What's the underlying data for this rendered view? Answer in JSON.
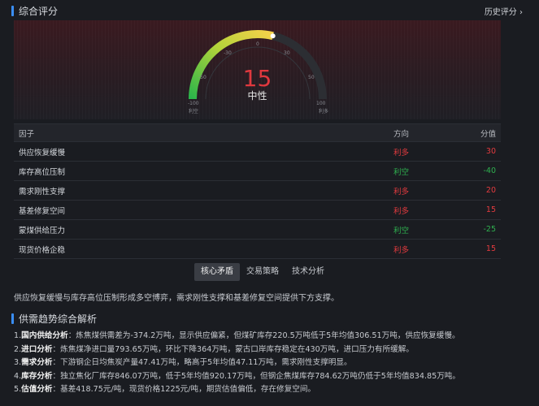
{
  "header": {
    "title": "综合评分",
    "history_link": "历史评分"
  },
  "gauge": {
    "value": "15",
    "label": "中性",
    "score_fraction": 0.575,
    "tick_labels": [
      "-100",
      "-50",
      "-30",
      "0",
      "30",
      "50",
      "100"
    ],
    "left_caption": "利空",
    "right_caption": "利多",
    "colors": {
      "start": "#2bb64a",
      "mid": "#c9d82e",
      "end": "#f6c94a",
      "track": "#2c2e33"
    }
  },
  "table": {
    "columns": [
      "因子",
      "方向",
      "分值"
    ],
    "rows": [
      {
        "factor": "供应恢复缓慢",
        "direction": "利多",
        "score": "30",
        "tone": "red"
      },
      {
        "factor": "库存高位压制",
        "direction": "利空",
        "score": "-40",
        "tone": "green"
      },
      {
        "factor": "需求刚性支撑",
        "direction": "利多",
        "score": "20",
        "tone": "red"
      },
      {
        "factor": "基差修复空间",
        "direction": "利多",
        "score": "15",
        "tone": "red"
      },
      {
        "factor": "蒙煤供给压力",
        "direction": "利空",
        "score": "-25",
        "tone": "green"
      },
      {
        "factor": "现货价格企稳",
        "direction": "利多",
        "score": "15",
        "tone": "red"
      }
    ]
  },
  "tabs": [
    {
      "label": "核心矛盾",
      "active": true
    },
    {
      "label": "交易策略",
      "active": false
    },
    {
      "label": "技术分析",
      "active": false
    }
  ],
  "summary": "供应恢复缓慢与库存高位压制形成多空博弈，需求刚性支撑和基差修复空间提供下方支撑。",
  "analysis": {
    "title": "供需趋势综合解析",
    "items": [
      {
        "index": "1.",
        "head": "国内供给分析",
        "body": "：炼焦煤供需差为-374.2万吨，显示供应偏紧，但煤矿库存220.5万吨低于5年均值306.51万吨，供应恢复缓慢。"
      },
      {
        "index": "2.",
        "head": "进口分析",
        "body": "：炼焦煤净进口量793.65万吨，环比下降364万吨，蒙古口岸库存稳定在430万吨，进口压力有所缓解。"
      },
      {
        "index": "3.",
        "head": "需求分析",
        "body": "：下游钢企日均焦炭产量47.41万吨，略高于5年均值47.11万吨，需求刚性支撑明显。"
      },
      {
        "index": "4.",
        "head": "库存分析",
        "body": "：独立焦化厂库存846.07万吨，低于5年均值920.17万吨，但钢企焦煤库存784.62万吨仍低于5年均值834.85万吨。"
      },
      {
        "index": "5.",
        "head": "估值分析",
        "body": "：基差418.75元/吨，现货价格1225元/吨，期货估值偏低，存在修复空间。"
      }
    ]
  }
}
